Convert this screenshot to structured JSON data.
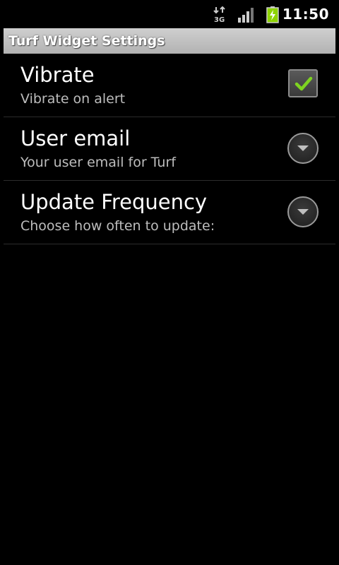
{
  "status_bar": {
    "network_icon": "3g-data-arrows-icon",
    "signal_icon": "signal-bars-icon",
    "battery_icon": "battery-charging-icon",
    "time": "11:50",
    "battery_color": "#8ed400"
  },
  "title_bar": {
    "title": "Turf Widget Settings"
  },
  "preferences": [
    {
      "title": "Vibrate",
      "summary": "Vibrate on alert",
      "widget": "checkbox",
      "checked": true,
      "icon": "checkmark-icon"
    },
    {
      "title": "User email",
      "summary": "Your user email for Turf",
      "widget": "dropdown",
      "icon": "chevron-down-icon"
    },
    {
      "title": "Update Frequency",
      "summary": "Choose how often to update:",
      "widget": "dropdown",
      "icon": "chevron-down-icon"
    }
  ],
  "colors": {
    "background": "#000000",
    "check_green": "#7ed321",
    "title_bar_gray": "#c2c2c2"
  }
}
